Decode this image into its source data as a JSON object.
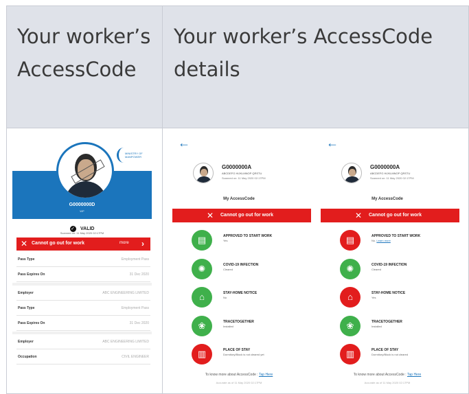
{
  "header": {
    "left_title": "Your worker’s AccessCode",
    "right_title": "Your worker’s AccessCode details"
  },
  "left_phone": {
    "worker_id": "G0000000D",
    "subtitle": "WP",
    "logo_text": "MINISTRY OF MANPOWER",
    "valid_label": "VALID",
    "scanned_text": "Scanned on: 11 May 2020 02:17PM",
    "status_text": "Cannot go out for work",
    "more_label": "more",
    "rows": [
      {
        "key": "Pass Type",
        "value": "Employment Pass"
      },
      {
        "key": "Pass Expires On",
        "value": "31 Dec 2020"
      },
      {
        "key": "Employer",
        "value": "ABC ENGINEERING LIMITED"
      },
      {
        "key": "Pass Type",
        "value": "Employment Pass"
      },
      {
        "key": "Pass Expires On",
        "value": "31 Dec 2020"
      },
      {
        "key": "Employer",
        "value": "ABC ENGINEERING LIMITED"
      },
      {
        "key": "Occupation",
        "value": "CIVIL ENGINEER"
      }
    ]
  },
  "right_phones": [
    {
      "worker_id": "G0000000A",
      "worker_name": "ABCDEFG HIJKLMNOP QRSTU",
      "scanned_text": "Scanned on: 11 May 2020 02:17PM",
      "section_title": "My AccessCode",
      "status_text": "Cannot go out for work",
      "items": [
        {
          "label": "APPROVED TO START WORK",
          "value": "Yes",
          "link": "",
          "color": "#3fb04b",
          "icon": "document-icon"
        },
        {
          "label": "COVID-19 INFECTION",
          "value": "Cleared",
          "link": "",
          "color": "#3fb04b",
          "icon": "virus-icon"
        },
        {
          "label": "STAY-HOME NOTICE",
          "value": "No",
          "link": "",
          "color": "#3fb04b",
          "icon": "home-icon"
        },
        {
          "label": "TRACETOGETHER",
          "value": "Installed",
          "link": "",
          "color": "#3fb04b",
          "icon": "tracetogether-icon"
        },
        {
          "label": "PLACE OF STAY",
          "value": "Dormitory/Block is not cleared yet",
          "link": "",
          "color": "#e21d1d",
          "icon": "building-icon"
        }
      ],
      "more_text": "To know more about AccessCode :",
      "more_link": "Tap Here",
      "footer": "Accurate as of 11 May 2020 02:17PM"
    },
    {
      "worker_id": "G0000000A",
      "worker_name": "ABCDEFG HIJKLMNOP QRSTU",
      "scanned_text": "Scanned on: 11 May 2020 02:17PM",
      "section_title": "My AccessCode",
      "status_text": "Cannot go out for work",
      "items": [
        {
          "label": "APPROVED TO START WORK",
          "value": "No.",
          "link": "Learn more",
          "color": "#e21d1d",
          "icon": "document-icon"
        },
        {
          "label": "COVID-19 INFECTION",
          "value": "Cleared",
          "link": "",
          "color": "#3fb04b",
          "icon": "virus-icon"
        },
        {
          "label": "STAY-HOME NOTICE",
          "value": "Yes",
          "link": "",
          "color": "#e21d1d",
          "icon": "home-icon"
        },
        {
          "label": "TRACETOGETHER",
          "value": "Installed",
          "link": "",
          "color": "#3fb04b",
          "icon": "tracetogether-icon"
        },
        {
          "label": "PLACE OF STAY",
          "value": "Dormitory/Block is not cleared",
          "link": "",
          "color": "#e21d1d",
          "icon": "building-icon"
        }
      ],
      "more_text": "To know more about AccessCode :",
      "more_link": "Tap Here",
      "footer": "Accurate as of 11 May 2020 02:17PM"
    }
  ],
  "colors": {
    "brand_blue": "#1b75bc",
    "status_red": "#e21d1d",
    "status_green": "#3fb04b",
    "header_bg": "#dfe2e9"
  }
}
